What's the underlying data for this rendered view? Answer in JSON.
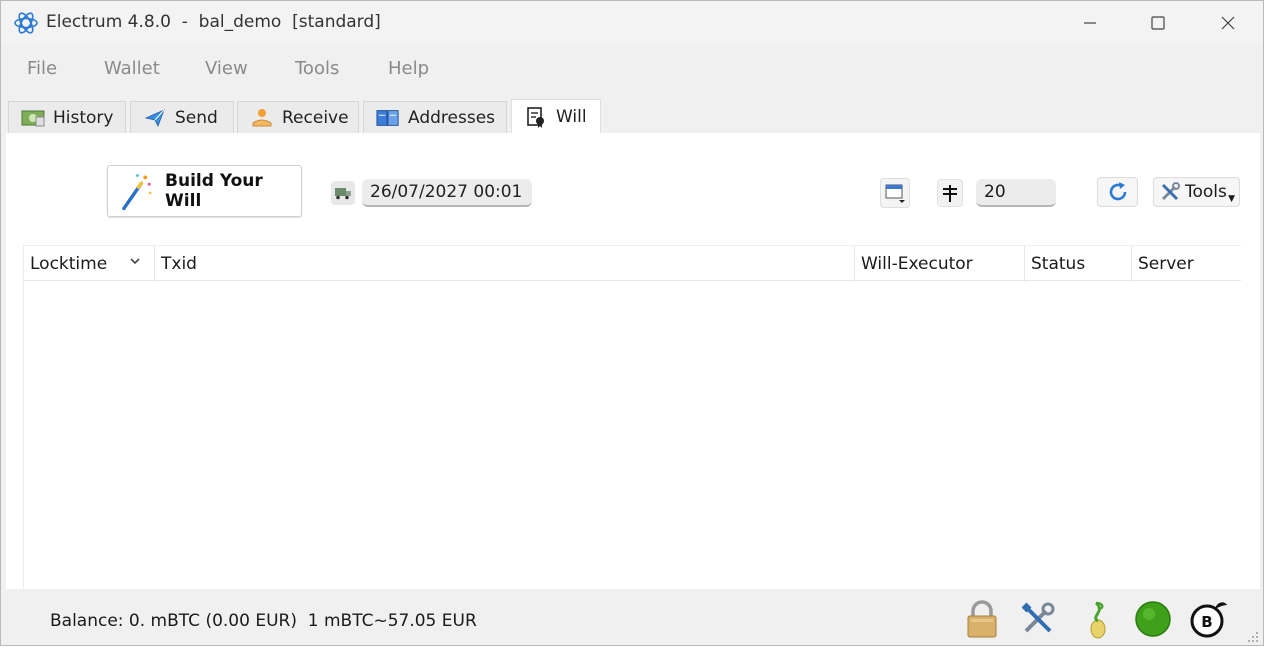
{
  "window": {
    "title": "Electrum 4.8.0  -  bal_demo  [standard]",
    "accent_color": "#1a73e8"
  },
  "menu": {
    "items": [
      "File",
      "Wallet",
      "View",
      "Tools",
      "Help"
    ]
  },
  "tabs": [
    {
      "label": "History",
      "icon": "history-icon"
    },
    {
      "label": "Send",
      "icon": "send-icon"
    },
    {
      "label": "Receive",
      "icon": "receive-icon"
    },
    {
      "label": "Addresses",
      "icon": "addresses-icon"
    },
    {
      "label": "Will",
      "icon": "will-icon",
      "active": true
    }
  ],
  "will": {
    "build_button_label": "Build Your Will",
    "locktime_value": "26/07/2027 00:01",
    "fee_value": "20",
    "tools_label": "Tools"
  },
  "table": {
    "columns": [
      "Locktime",
      "Txid",
      "Will-Executor",
      "Status",
      "Server"
    ],
    "rows": []
  },
  "status": {
    "balance_text": "Balance: 0. mBTC (0.00 EUR)  1 mBTC~57.05 EUR",
    "network_color": "#3fa11a"
  }
}
